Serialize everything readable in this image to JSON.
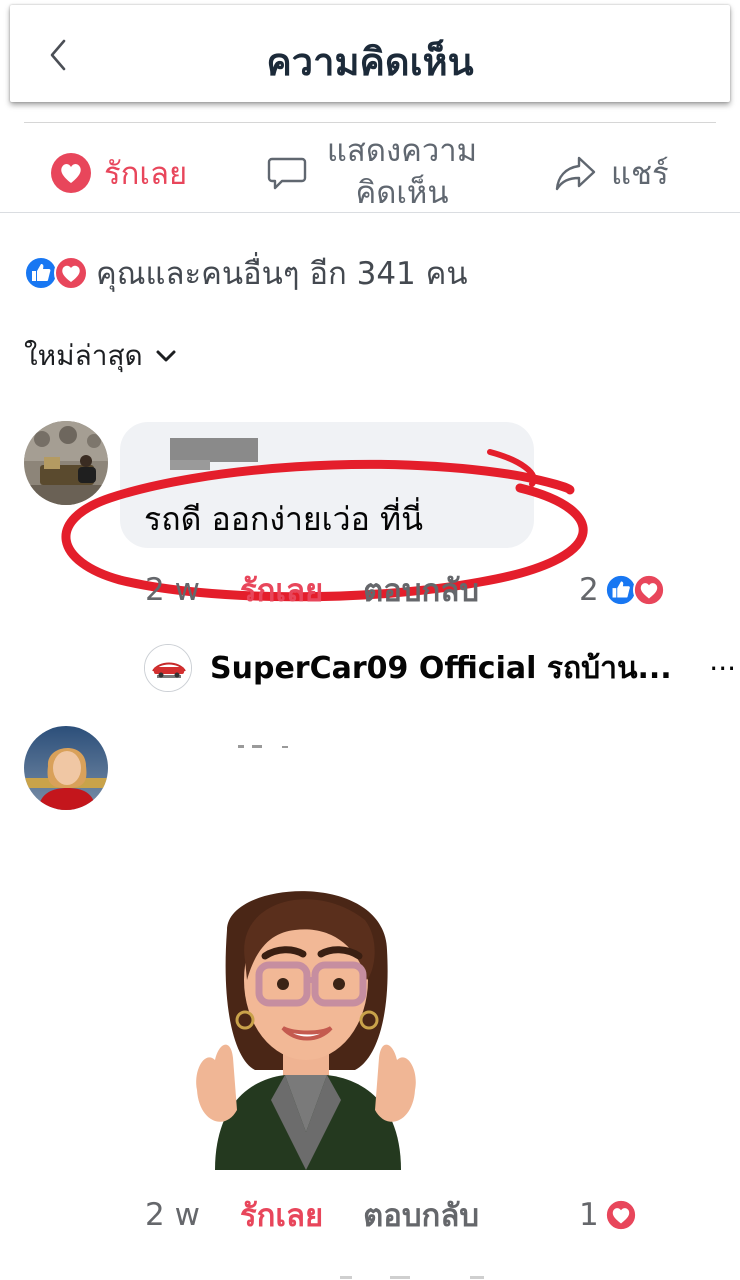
{
  "header": {
    "title": "ความคิดเห็น"
  },
  "actions": {
    "love_label": "รักเลย",
    "comment_label_line1": "แสดงความ",
    "comment_label_line2": "คิดเห็น",
    "share_label": "แชร์"
  },
  "reactions_summary": {
    "text": "คุณและคนอื่นๆ อีก 341 คน"
  },
  "sort": {
    "label": "ใหม่ล่าสุด"
  },
  "comments": [
    {
      "text": "รถดี ออกง่ายเว่อ ที่นี่",
      "time": "2 w",
      "love_label": "รักเลย",
      "reply_label": "ตอบกลับ",
      "reaction_count": "2",
      "reply": {
        "name": "SuperCar09 Official รถบ้าน...",
        "more": "..."
      }
    },
    {
      "time": "2 w",
      "love_label": "รักเลย",
      "reply_label": "ตอบกลับ",
      "reaction_count": "1"
    }
  ],
  "colors": {
    "love_red": "#e8465b",
    "like_blue": "#1877f2",
    "annotation_red": "#e41e2b",
    "title_dark": "#1c2a39"
  },
  "icons": [
    "chevron-left-icon",
    "heart-icon",
    "comment-bubble-icon",
    "share-arrow-icon",
    "like-reaction-icon",
    "love-reaction-icon",
    "chevron-down-icon"
  ]
}
